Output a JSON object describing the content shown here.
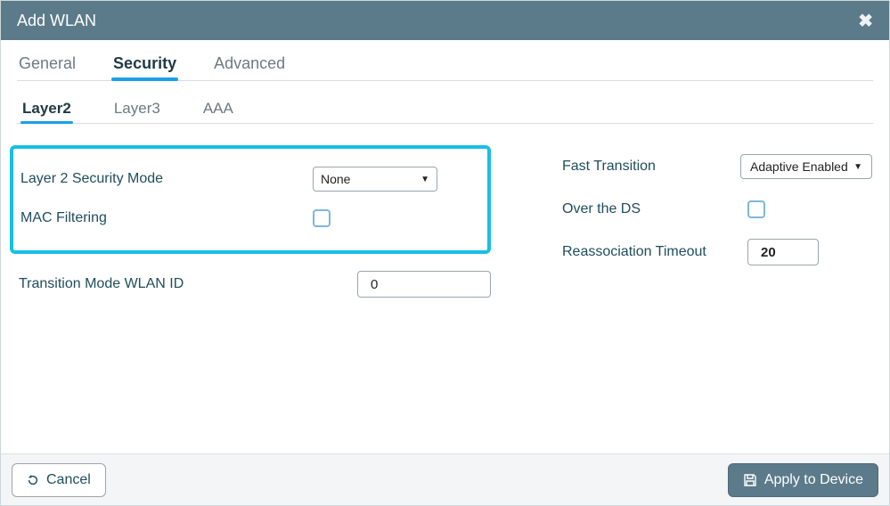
{
  "title": "Add WLAN",
  "tabs": {
    "general": "General",
    "security": "Security",
    "advanced": "Advanced",
    "active": "security"
  },
  "subtabs": {
    "layer2": "Layer2",
    "layer3": "Layer3",
    "aaa": "AAA",
    "active": "layer2"
  },
  "left": {
    "l2mode_label": "Layer 2 Security Mode",
    "l2mode_value": "None",
    "macfilter_label": "MAC Filtering",
    "macfilter_checked": false,
    "transition_label": "Transition Mode WLAN ID",
    "transition_value": "0"
  },
  "right": {
    "ft_label": "Fast Transition",
    "ft_value": "Adaptive Enabled",
    "overds_label": "Over the DS",
    "overds_checked": false,
    "reassoc_label": "Reassociation Timeout",
    "reassoc_value": "20"
  },
  "footer": {
    "cancel": "Cancel",
    "apply": "Apply to Device"
  }
}
